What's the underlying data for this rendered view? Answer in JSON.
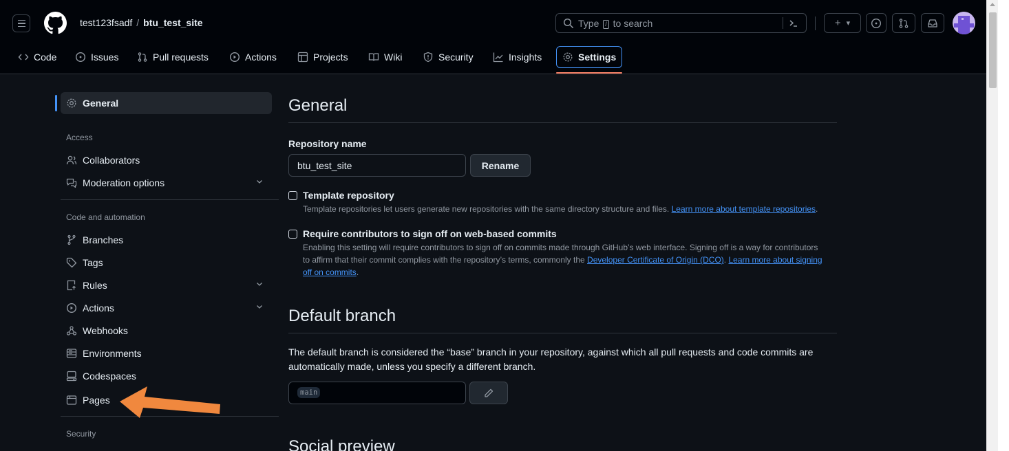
{
  "header": {
    "owner": "test123fsadf",
    "separator": "/",
    "repo": "btu_test_site",
    "search": {
      "placeholder_before": "Type",
      "key": "/",
      "placeholder_after": "to search",
      "command_glyph": "⪢"
    },
    "plus_glyph": "+",
    "dropdown_glyph": "▾"
  },
  "tabs": [
    {
      "icon": "code-icon",
      "label": "Code"
    },
    {
      "icon": "issue-icon",
      "label": "Issues"
    },
    {
      "icon": "pull-request-icon",
      "label": "Pull requests"
    },
    {
      "icon": "actions-icon",
      "label": "Actions"
    },
    {
      "icon": "projects-icon",
      "label": "Projects"
    },
    {
      "icon": "wiki-icon",
      "label": "Wiki"
    },
    {
      "icon": "security-icon",
      "label": "Security"
    },
    {
      "icon": "insights-icon",
      "label": "Insights"
    },
    {
      "icon": "gear-icon",
      "label": "Settings",
      "active": true
    }
  ],
  "sidebar": {
    "general": "General",
    "sections": {
      "access": "Access",
      "code_automation": "Code and automation",
      "security": "Security"
    },
    "items": {
      "collaborators": "Collaborators",
      "moderation": "Moderation options",
      "branches": "Branches",
      "tags": "Tags",
      "rules": "Rules",
      "actions": "Actions",
      "webhooks": "Webhooks",
      "environments": "Environments",
      "codespaces": "Codespaces",
      "pages": "Pages"
    }
  },
  "main": {
    "general_title": "General",
    "repo_name_label": "Repository name",
    "repo_name_value": "btu_test_site",
    "rename_label": "Rename",
    "template": {
      "title": "Template repository",
      "desc": "Template repositories let users generate new repositories with the same directory structure and files.",
      "link": "Learn more about template repositories",
      "end": "."
    },
    "signoff": {
      "title": "Require contributors to sign off on web-based commits",
      "desc": "Enabling this setting will require contributors to sign off on commits made through GitHub’s web interface. Signing off is a way for contributors to affirm that their commit complies with the repository’s terms, commonly the",
      "link_dco": "Developer Certificate of Origin (DCO)",
      "sep": ".",
      "link_learn": "Learn more about signing off on commits",
      "end": "."
    },
    "default_branch_title": "Default branch",
    "default_branch_desc": "The default branch is considered the “base” branch in your repository, against which all pull requests and code commits are automatically made, unless you specify a different branch.",
    "default_branch_value": "main",
    "social_preview_title": "Social preview"
  },
  "colors": {
    "accent": "#4493f8",
    "underline": "#f78166",
    "annotation_arrow": "#f0883e"
  }
}
